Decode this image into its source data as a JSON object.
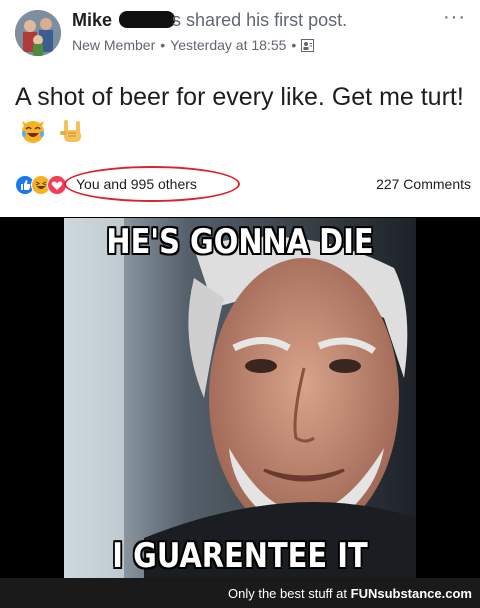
{
  "post": {
    "author_name": "Mike",
    "author_suffix": "s shared his first post.",
    "member_badge": "New Member",
    "timestamp": "Yesterday at 18:55",
    "more_label": "···",
    "text": "A shot of beer for every like. Get me turt!",
    "reaction_summary": "You and 995 others",
    "comment_count": "227 Comments",
    "reaction_icons": [
      "like-icon",
      "haha-icon",
      "love-icon"
    ]
  },
  "meme": {
    "top_caption": "HE'S GONNA DIE",
    "bottom_caption": "I GUARENTEE IT"
  },
  "footer": {
    "tagline": "Only the best stuff at",
    "brand": "FUNsubstance.com"
  },
  "colors": {
    "like": "#1877f2",
    "haha": "#f7b125",
    "love": "#f33e58",
    "highlight_circle": "#d9232f"
  }
}
